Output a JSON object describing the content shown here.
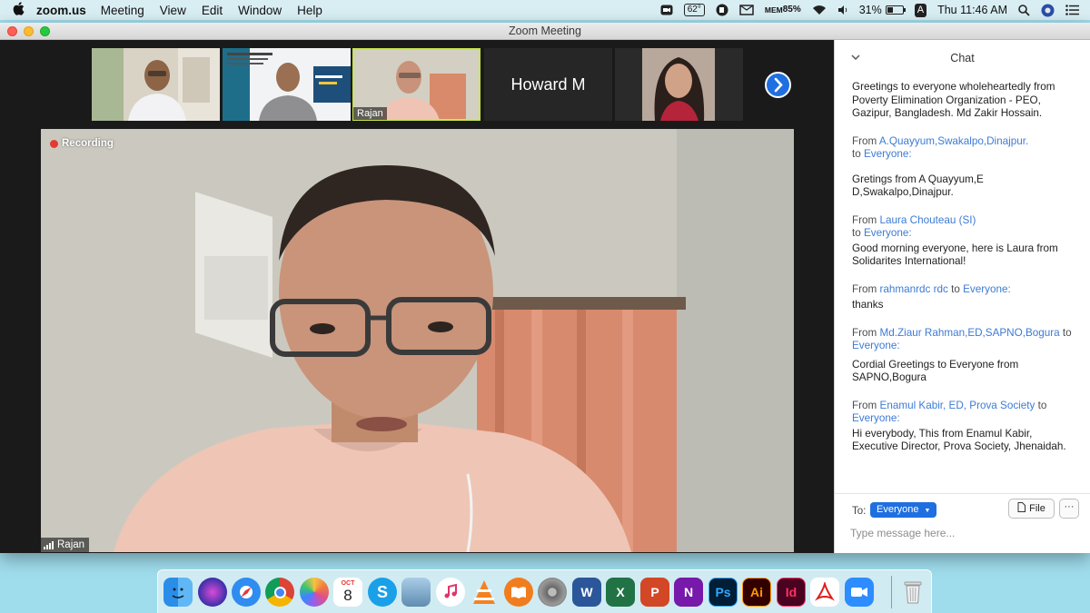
{
  "menubar": {
    "app_name": "zoom.us",
    "menus": [
      "Meeting",
      "View",
      "Edit",
      "Window",
      "Help"
    ],
    "status": {
      "temperature": "62°",
      "mem_label": "MEM",
      "mem_value": "85%",
      "battery": "31%",
      "input_source": "A",
      "clock": "Thu 11:46 AM"
    }
  },
  "window": {
    "title": "Zoom Meeting"
  },
  "gallery": {
    "tiles": [
      {
        "label": ""
      },
      {
        "label": ""
      },
      {
        "label": "Rajan"
      },
      {
        "name": "Howard M"
      },
      {
        "label": ""
      }
    ]
  },
  "main_video": {
    "recording_label": "Recording",
    "speaker_label": "Rajan"
  },
  "chat": {
    "title": "Chat",
    "messages": [
      {
        "from": "",
        "to": "",
        "text": "Greetings to everyone  wholeheartedly  from Poverty Elimination Organization - PEO, Gazipur, Bangladesh.  Md Zakir Hossain."
      },
      {
        "from": "A.Quayyum,Swakalpo,Dinajpur.",
        "to": "Everyone:",
        "text": "Gretings from A Quayyum,E D,Swakalpo,Dinajpur."
      },
      {
        "from": "Laura Chouteau (SI)",
        "to": "Everyone:",
        "text": "Good morning everyone, here is Laura from Solidarites International!"
      },
      {
        "from": "rahmanrdc rdc",
        "to": "Everyone:",
        "text": "thanks"
      },
      {
        "from": "Md.Ziaur Rahman,ED,SAPNO,Bogura",
        "to": "Everyone:",
        "text": "Cordial Greetings to Everyone from SAPNO,Bogura"
      },
      {
        "from": "Enamul Kabir, ED, Prova Society",
        "to": "Everyone:",
        "text": "Hi everybody, This from Enamul Kabir, Executive Director, Prova Society, Jhenaidah."
      }
    ],
    "from_word": "From",
    "to_word": "to",
    "to_label": "To:",
    "to_value": "Everyone",
    "file_button": "File",
    "more_button": "···",
    "input_placeholder": "Type message here..."
  },
  "dock": {
    "calendar_month": "OCT",
    "calendar_day": "8",
    "apps": [
      "Finder",
      "Siri",
      "Safari",
      "Chrome",
      "Photos",
      "Calendar",
      "Skype",
      "Preview",
      "iTunes",
      "VLC",
      "Books",
      "System Preferences",
      "Word",
      "Excel",
      "PowerPoint",
      "OneNote",
      "Photoshop",
      "Illustrator",
      "InDesign",
      "Acrobat",
      "Zoom",
      "Trash"
    ]
  }
}
